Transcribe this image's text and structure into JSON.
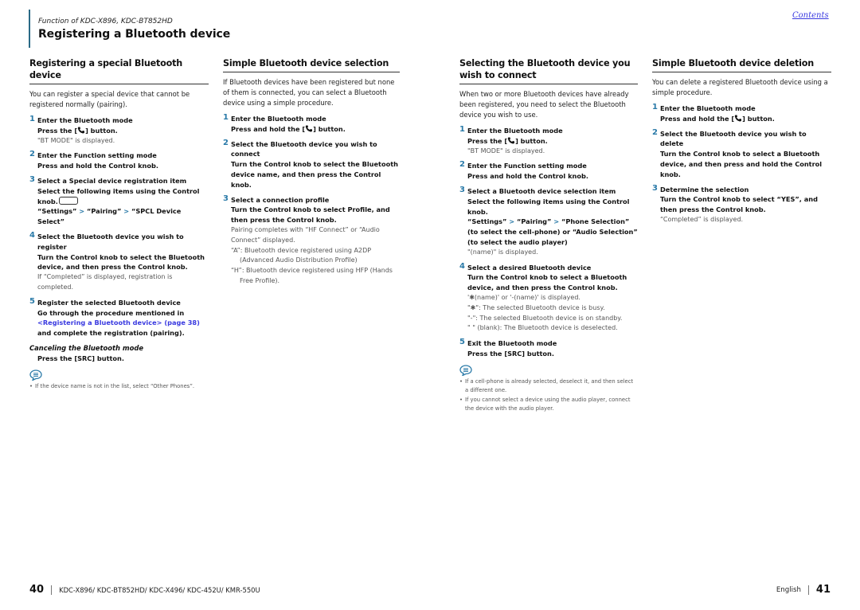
{
  "header": {
    "function_of": "Function of KDC-X896, KDC-BT852HD",
    "title": "Registering a Bluetooth device",
    "contents_link": "Contents"
  },
  "sections": [
    {
      "title": "Registering a special Bluetooth device",
      "intro": "You can register a special device that cannot be registered normally (pairing).",
      "steps": [
        {
          "num": "1",
          "title": "Enter the Bluetooth mode",
          "instr_pre": "Press the [",
          "instr_post": "] button.",
          "note": "\"BT MODE\" is displayed."
        },
        {
          "num": "2",
          "title": "Enter the Function setting mode",
          "instr": "Press and hold the Control knob."
        },
        {
          "num": "3",
          "title": "Select a Special device registration item",
          "instr": "Select the following items using the Control knob.",
          "path": [
            "“Settings”",
            "“Pairing”",
            "“SPCL Device Select”"
          ]
        },
        {
          "num": "4",
          "title": "Select the Bluetooth device you wish to register",
          "instr": "Turn the Control knob to select the Bluetooth device, and then press the Control knob.",
          "note": "If “Completed” is displayed, registration is completed."
        },
        {
          "num": "5",
          "title": "Register the selected Bluetooth device",
          "instr_pre": "Go through the procedure mentioned in",
          "link": "<Registering a Bluetooth device> (page 38)",
          "instr_post": "and complete the registration (pairing)."
        }
      ],
      "cancel": {
        "title": "Canceling the Bluetooth mode",
        "instr": "Press the [SRC] button."
      },
      "notes": [
        "If the device name is not in the list, select “Other Phones”."
      ]
    },
    {
      "title": "Simple Bluetooth device selection",
      "intro": "If Bluetooth devices have been registered but none of them is connected, you can select a Bluetooth device using a simple procedure.",
      "steps": [
        {
          "num": "1",
          "title": "Enter the Bluetooth mode",
          "instr_pre": "Press and hold the [",
          "instr_post": "] button."
        },
        {
          "num": "2",
          "title": "Select the Bluetooth device you wish to connect",
          "instr": "Turn the Control knob to select the Bluetooth device name, and then press the Control knob."
        },
        {
          "num": "3",
          "title": "Select a connection profile",
          "instr": "Turn the Control knob to select Profile, and then press the Control knob.",
          "notes": [
            "Pairing completes with “HF Connect” or “Audio Connect” displayed.",
            "“A”: Bluetooth device registered using A2DP (Advanced Audio Distribution Profile)",
            "“H”: Bluetooth device registered using HFP (Hands Free Profile)."
          ]
        }
      ]
    },
    {
      "title": "Selecting the Bluetooth device you wish to connect",
      "intro": "When two or more Bluetooth devices have already been registered, you need to select the Bluetooth device you wish to use.",
      "steps": [
        {
          "num": "1",
          "title": "Enter the Bluetooth mode",
          "instr_pre": "Press the [",
          "instr_post": "] button.",
          "note": "\"BT MODE\" is displayed."
        },
        {
          "num": "2",
          "title": "Enter the Function setting mode",
          "instr": "Press and hold the Control knob."
        },
        {
          "num": "3",
          "title": "Select a Bluetooth device selection item",
          "instr": "Select the following items using the Control knob.",
          "path": [
            "“Settings”",
            "“Pairing”",
            "“Phone Selection” (to select the cell-phone) or “Audio Selection” (to select the audio player)"
          ],
          "note": "\"(name)\" is displayed."
        },
        {
          "num": "4",
          "title": "Select a desired Bluetooth device",
          "instr": "Turn the Control knob to select a Bluetooth device, and then press the Control knob.",
          "notes": [
            "'✱(name)' or '-(name)' is displayed.",
            "\"✱\": The selected Bluetooth device is busy.",
            "\"-\": The selected Bluetooth device is on standby.",
            "\" \" (blank): The Bluetooth device is deselected."
          ]
        },
        {
          "num": "5",
          "title": "Exit the Bluetooth mode",
          "instr": "Press the [SRC] button."
        }
      ],
      "notes": [
        "If a cell-phone is already selected, deselect it, and then select a different one.",
        "If you cannot select a device using the audio player, connect the device with the audio player."
      ]
    },
    {
      "title": "Simple Bluetooth device deletion",
      "intro": "You can delete a registered Bluetooth device using a simple procedure.",
      "steps": [
        {
          "num": "1",
          "title": "Enter the Bluetooth mode",
          "instr_pre": "Press and hold the [",
          "instr_post": "] button."
        },
        {
          "num": "2",
          "title": "Select the Bluetooth device you wish to delete",
          "instr": "Turn the Control knob to select a Bluetooth device, and then press and hold the Control knob."
        },
        {
          "num": "3",
          "title": "Determine the selection",
          "instr": "Turn the Control knob to select “YES”, and then press the Control knob.",
          "note": "“Completed” is displayed."
        }
      ]
    }
  ],
  "footer": {
    "left_page": "40",
    "models": "KDC-X896/ KDC-BT852HD/ KDC-X496/ KDC-452U/ KMR-550U",
    "language": "English",
    "right_page": "41"
  },
  "colors": {
    "accent": "#2a7aa8",
    "link": "#3a3ae0",
    "header_bar": "#2a6a86"
  }
}
